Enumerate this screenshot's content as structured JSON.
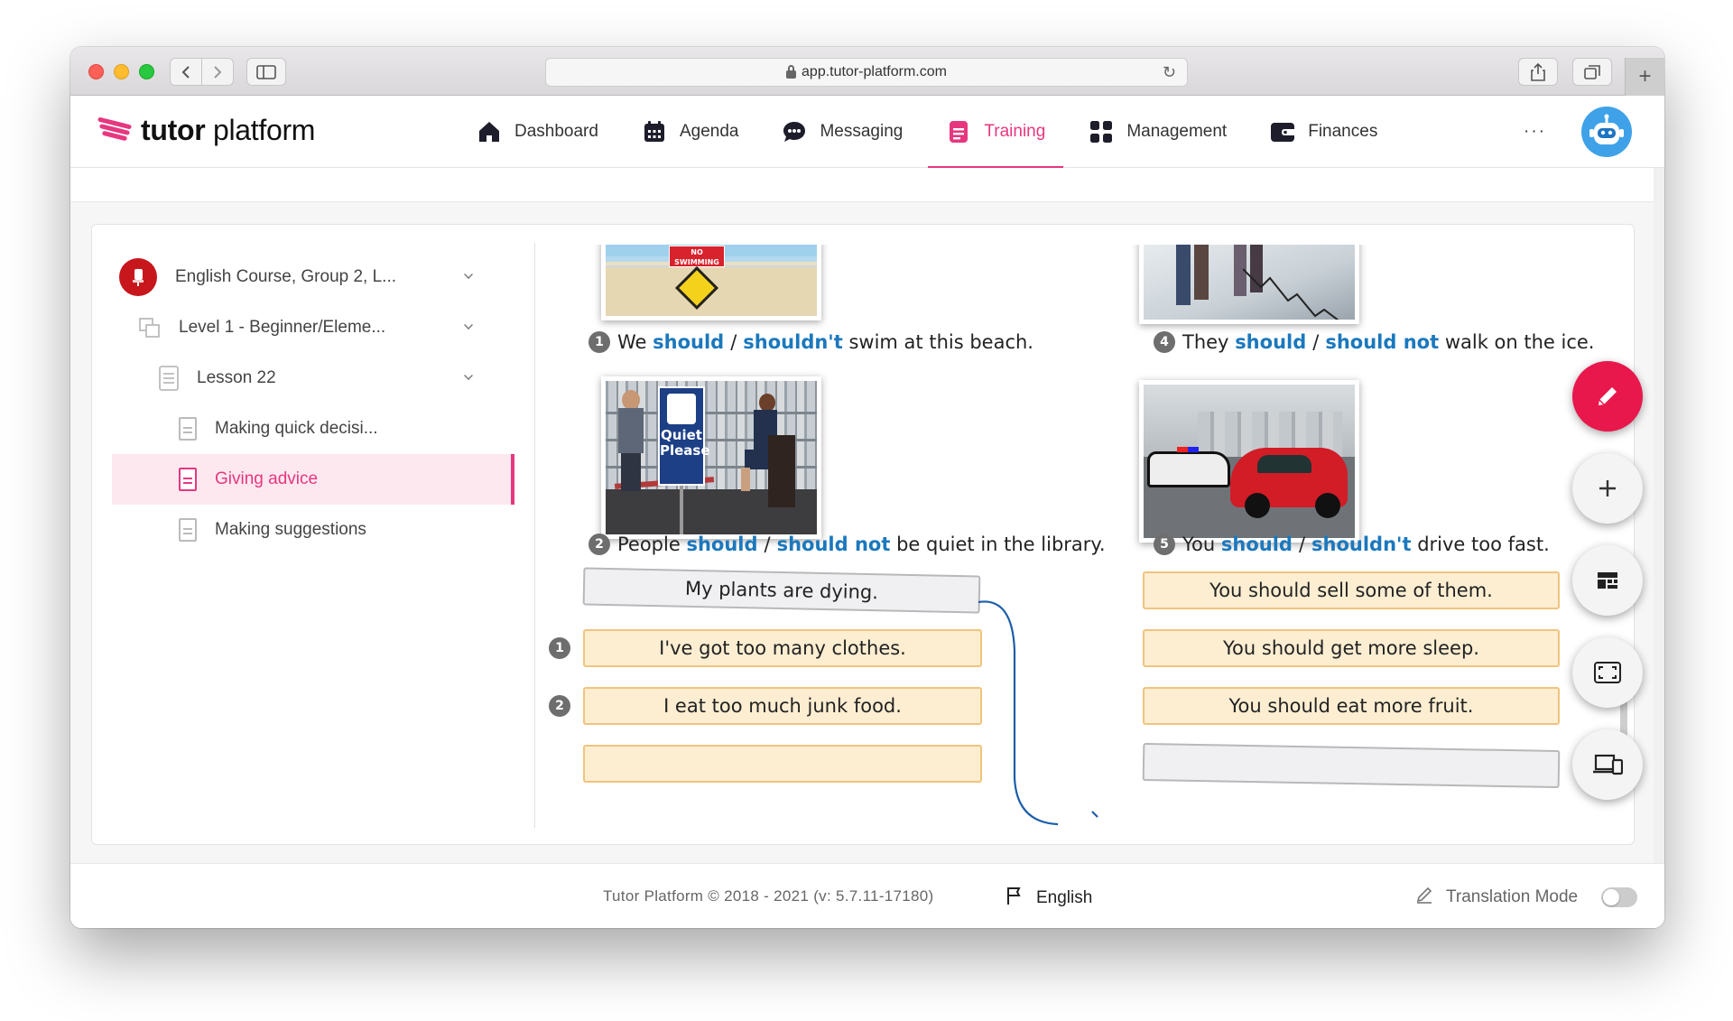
{
  "browser": {
    "url": "app.tutor-platform.com"
  },
  "app": {
    "logo_bold": "tutor",
    "logo_light": "platform",
    "brand_color": "#e6377f"
  },
  "nav": {
    "items": [
      {
        "label": "Dashboard",
        "icon": "home-icon"
      },
      {
        "label": "Agenda",
        "icon": "calendar-icon"
      },
      {
        "label": "Messaging",
        "icon": "chat-icon"
      },
      {
        "label": "Training",
        "icon": "document-icon",
        "active": true
      },
      {
        "label": "Management",
        "icon": "grid-icon"
      },
      {
        "label": "Finances",
        "icon": "wallet-icon"
      }
    ],
    "more": "···"
  },
  "sidebar": {
    "course": "English Course, Group 2, L...",
    "level": "Level 1 - Beginner/Eleme...",
    "lesson": "Lesson 22",
    "items": [
      {
        "label": "Making quick decisi..."
      },
      {
        "label": "Giving advice",
        "active": true
      },
      {
        "label": "Making suggestions"
      }
    ]
  },
  "exercise": {
    "pictures": {
      "beach_sign": "NO SWIMMING",
      "library_sign_1": "Quiet",
      "library_sign_2": "Please"
    },
    "sentences": [
      {
        "num": "1",
        "pre": "We",
        "opt1": "should",
        "sep": "/",
        "opt2": "shouldn't",
        "post": "swim at this beach."
      },
      {
        "num": "2",
        "pre": "People",
        "opt1": "should",
        "sep": "/",
        "opt2": "should not",
        "post": "be quiet in the library."
      },
      {
        "num": "4",
        "pre": "They",
        "opt1": "should",
        "sep": "/",
        "opt2": "should not",
        "post": "walk on the ice."
      },
      {
        "num": "5",
        "pre": "You",
        "opt1": "should",
        "sep": "/",
        "opt2": "shouldn't",
        "post": "drive too fast."
      }
    ],
    "problem": "My plants are dying.",
    "problems_numbered": [
      {
        "num": "1",
        "text": "I've got too many clothes."
      },
      {
        "num": "2",
        "text": "I eat too much junk food."
      }
    ],
    "advice": [
      "You should sell some of them.",
      "You should get more sleep.",
      "You should eat more fruit."
    ],
    "highlight_color": "#1b78bd"
  },
  "fabs": [
    {
      "name": "edit-button",
      "icon": "pencil-icon"
    },
    {
      "name": "add-button",
      "icon": "plus-icon"
    },
    {
      "name": "layout-button",
      "icon": "layout-icon"
    },
    {
      "name": "fullscreen-button",
      "icon": "fullscreen-icon"
    },
    {
      "name": "devices-button",
      "icon": "devices-icon"
    }
  ],
  "footer": {
    "copyright": "Tutor Platform © 2018 - 2021 (v: 5.7.11-17180)",
    "language": "English",
    "translation_mode": "Translation Mode",
    "translation_mode_on": false
  }
}
